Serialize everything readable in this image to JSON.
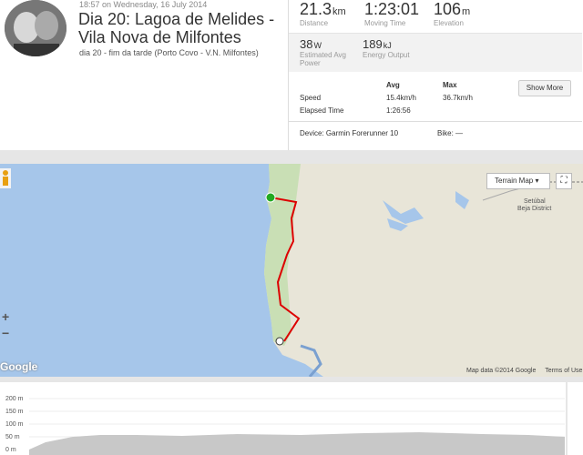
{
  "header": {
    "timestamp": "18:57 on Wednesday, 16 July 2014",
    "title": "Dia 20: Lagoa de Melides - Vila Nova de Milfontes",
    "description": "dia 20 - fim da tarde (Porto Covo - V.N. Milfontes)"
  },
  "stats": {
    "distance": {
      "value": "21.3",
      "unit": "km",
      "label": "Distance"
    },
    "moving_time": {
      "value": "1:23:01",
      "label": "Moving Time"
    },
    "elevation": {
      "value": "106",
      "unit": "m",
      "label": "Elevation"
    },
    "power": {
      "value": "38",
      "unit": "W",
      "label": "Estimated Avg Power"
    },
    "energy": {
      "value": "189",
      "unit": "kJ",
      "label": "Energy Output"
    }
  },
  "table": {
    "headers": [
      "Avg",
      "Max"
    ],
    "rows": [
      {
        "label": "Speed",
        "avg": "15.4km/h",
        "max": "36.7km/h"
      },
      {
        "label": "Elapsed Time",
        "avg": "1:26:56",
        "max": ""
      }
    ],
    "show_more": "Show More"
  },
  "device": {
    "label": "Device: Garmin Forerunner 10",
    "bike": "Bike: —"
  },
  "map": {
    "type_button": "Terrain Map",
    "place_label": "Setúbal\nBeja District",
    "google": "Google",
    "attribution": [
      "Map data ©2014 Google",
      "Terms of Use"
    ],
    "zoom_in": "+",
    "zoom_out": "−"
  },
  "elevation_chart": {
    "y_ticks": [
      "200 m",
      "150 m",
      "100 m",
      "50 m",
      "0 m"
    ],
    "ylim": [
      0,
      200
    ]
  },
  "colors": {
    "route": "#dd0000",
    "sea": "#a6c6ea",
    "land": "#e8e5d8",
    "start": "#22aa22"
  }
}
